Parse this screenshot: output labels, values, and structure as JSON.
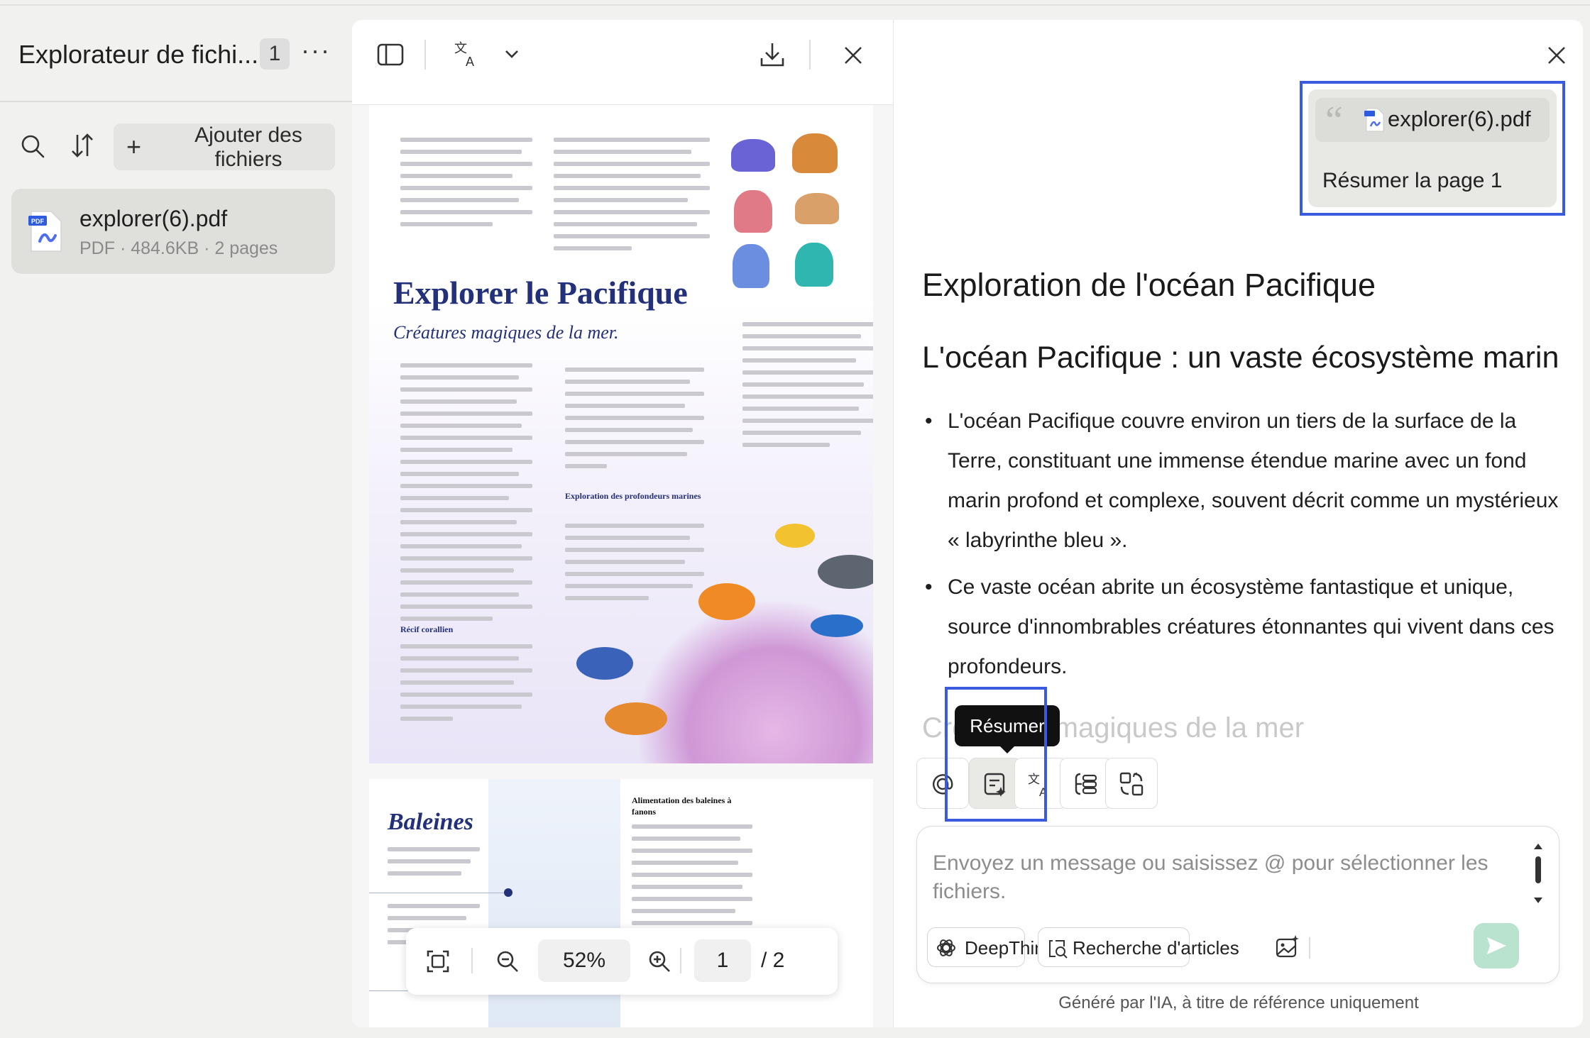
{
  "left_panel": {
    "title": "Explorateur de fichi...",
    "count": "1",
    "more": "···",
    "add_files": "Ajouter des fichiers",
    "file": {
      "name": "explorer(6).pdf",
      "meta": "PDF · 484.6KB · 2 pages"
    }
  },
  "viewer": {
    "page1": {
      "title": "Explorer le Pacifique",
      "subtitle": "Créatures magiques de la mer.",
      "section_deep": "Exploration des profondeurs marines",
      "section_reef": "Récif corallien"
    },
    "page2": {
      "title": "Baleines",
      "section_feeding": "Alimentation des baleines à fanons"
    },
    "zoom": "52%",
    "page_current": "1",
    "page_total": "/ 2"
  },
  "chat": {
    "quote_file": "explorer(6).pdf",
    "quote_text": "Résumer la page 1",
    "heading1": "Exploration de l'océan Pacifique",
    "heading2": "L'océan Pacifique : un vaste écosystème marin",
    "bullets": [
      "L'océan Pacifique couvre environ un tiers de la surface de la Terre, constituant une immense étendue marine avec un fond marin profond et complexe, souvent décrit comme un mystérieux « labyrinthe bleu ».",
      "Ce vaste océan abrite un écosystème fantastique et unique, source d'innombrables créatures étonnantes qui vivent dans ces profondeurs."
    ],
    "faded_line": "Créatures magiques de la mer",
    "tooltip": "Résumer",
    "input_placeholder": "Envoyez un message ou saisissez @ pour sélectionner les fichiers.",
    "chip_deepthink": "DeepThink",
    "chip_research": "Recherche d'articles",
    "disclaimer": "Généré par l'IA, à titre de référence uniquement"
  },
  "colors": {
    "highlight": "#3a5be0",
    "title_navy": "#23307a",
    "send": "#b9e2cf"
  }
}
